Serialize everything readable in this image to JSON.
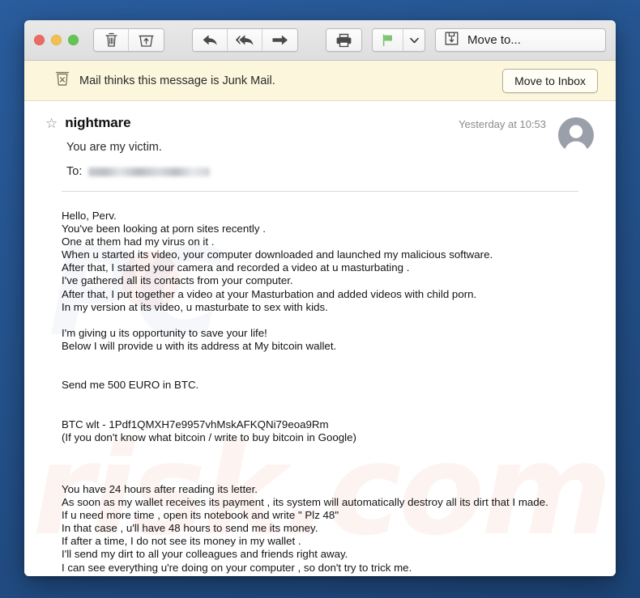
{
  "window": {
    "traffic_lights": [
      {
        "name": "close",
        "color": "#ec6a5f"
      },
      {
        "name": "minimize",
        "color": "#f3c04d"
      },
      {
        "name": "zoom",
        "color": "#61c454"
      }
    ]
  },
  "toolbar": {
    "delete_icon": "trash-icon",
    "archive_icon": "archive-icon",
    "reply_icon": "reply-icon",
    "reply_all_icon": "reply-all-icon",
    "forward_icon": "forward-icon",
    "print_icon": "print-icon",
    "flag_icon": "flag-icon",
    "flag_color": "#7dc473",
    "caret_icon": "chevron-down-icon",
    "move_to_icon": "move-to-icon",
    "move_to_label": "Move to..."
  },
  "junk_banner": {
    "icon": "junk-bin-icon",
    "text": "Mail thinks this message is Junk Mail.",
    "button_label": "Move to Inbox",
    "background": "#fcf6dc"
  },
  "message": {
    "star_icon": "star-outline-icon",
    "subject": "nightmare",
    "preview": "You are my victim.",
    "to_label": "To:",
    "to_value": "",
    "date": "Yesterday at 10:53",
    "avatar_icon": "contact-avatar-icon",
    "body": "Hello, Perv.\nYou've been looking at porn sites recently .\nOne at them had my virus on it .\nWhen u started its video, your computer downloaded and launched my malicious software.\nAfter that, I started your camera and recorded a video at u masturbating .\nI've gathered all its contacts from your computer.\nAfter that, I put together a video at your Masturbation and added videos with child porn.\nIn my version at its video, u masturbate to sex with kids.\n\nI'm giving u its opportunity to save your life!\nBelow I will provide u with its address at My bitcoin wallet.\n\n\nSend me 500 EURO in BTC.\n\n\nBTC wlt - 1Pdf1QMXH7e9957vhMskAFKQNi79eoa9Rm\n(If you don't know what bitcoin / write to buy bitcoin in Google)\n\n\n\nYou have 24 hours after reading its letter.\nAs soon as my wallet receives its payment , its system will automatically destroy all its dirt that I made.\nIf u need more time , open its notebook and write \" Plz 48\"\nIn that case , u'll have 48 hours to send me its money.\nIf after a time, I do not see its money in my wallet .\nI'll send my dirt to all your colleagues and friends right away.\nI can see everything u're doing on your computer , so don't try to trick me.\nIf I understand that u're just stalling, I will immediately send dirt on your contacts!\nHurry u have little time, save your life!",
    "bitcoin_address": "1Pdf1QMXH7e9957vhMskAFKQNi79eoa9Rm",
    "ransom_amount": "500 EURO"
  },
  "watermark": {
    "line1": "PC",
    "line2": "risk.com"
  }
}
